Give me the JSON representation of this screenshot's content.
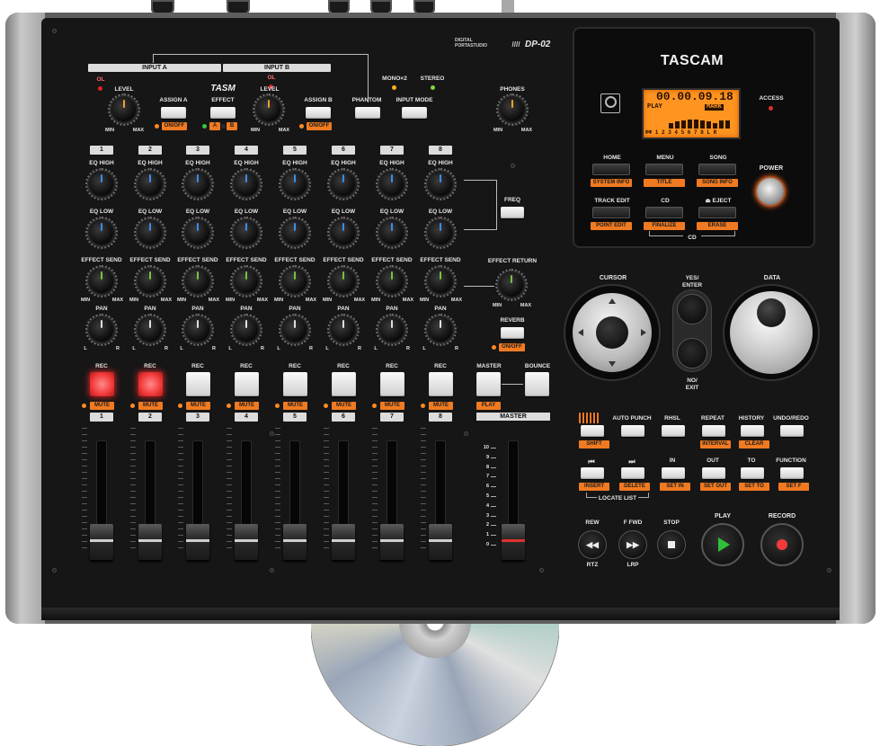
{
  "device": {
    "brand": "TASCAM",
    "panel_brand": "TASM",
    "model_small": "DIGITAL\nPORTASTUDIO",
    "model_slashes": "////",
    "model": "DP-02"
  },
  "inputs": {
    "input_a": "INPUT A",
    "input_b": "INPUT B",
    "ol": "OL",
    "level": "LEVEL",
    "min": "MIN",
    "max": "MAX",
    "assign_a": "ASSIGN A",
    "assign_b": "ASSIGN B",
    "effect": "EFFECT",
    "on_off": "ON/OFF",
    "a": "A",
    "b": "B",
    "phantom": "PHANTOM",
    "mono_x2": "MONO×2",
    "stereo": "STEREO",
    "input_mode": "INPUT MODE",
    "phones": "PHONES"
  },
  "channels": [
    "1",
    "2",
    "3",
    "4",
    "5",
    "6",
    "7",
    "8"
  ],
  "mixer": {
    "eq_high": "EQ HIGH",
    "eq_low": "EQ LOW",
    "effect_send": "EFFECT SEND",
    "pan": "PAN",
    "l": "L",
    "r": "R",
    "min": "MIN",
    "max": "MAX",
    "freq": "FREQ",
    "effect_return": "EFFECT RETURN",
    "reverb": "REVERB",
    "on_off": "ON/OFF",
    "rec": "REC",
    "mute": "MUTE",
    "master": "MASTER",
    "bounce": "BOUNCE",
    "play": "PLAY",
    "master_strip": "MASTER",
    "fader_scale": [
      "10",
      "9",
      "8",
      "7",
      "6",
      "5",
      "4",
      "3",
      "2",
      "1",
      "0"
    ]
  },
  "display": {
    "time": "00.00.09.18",
    "status": "PLAY",
    "mark": "MARK",
    "access": "ACCESS",
    "meters": "ΦΦ 1 2 3 4 5 6 7 8 L R"
  },
  "top_buttons": [
    {
      "label": "HOME",
      "sub": "SYSTEM INFO"
    },
    {
      "label": "MENU",
      "sub": "TITLE"
    },
    {
      "label": "SONG",
      "sub": "SONG INFO"
    },
    {
      "label": "TRACK EDIT",
      "sub": "POINT EDIT"
    },
    {
      "label": "CD",
      "sub": "FINALIZE"
    },
    {
      "label": "⏏ EJECT",
      "sub": "ERASE"
    }
  ],
  "cd_group": "CD",
  "power": "POWER",
  "navigation": {
    "cursor": "CURSOR",
    "yes_enter": "YES/\nENTER",
    "no_exit": "NO/\nEXIT",
    "data": "DATA"
  },
  "function_row1": [
    {
      "label": "",
      "sub": "SHIFT"
    },
    {
      "label": "AUTO PUNCH",
      "sub": ""
    },
    {
      "label": "RHSL",
      "sub": ""
    },
    {
      "label": "REPEAT",
      "sub": "INTERVAL"
    },
    {
      "label": "HISTORY",
      "sub": "CLEAR"
    },
    {
      "label": "UNDO/REDO",
      "sub": ""
    }
  ],
  "function_row2": [
    {
      "label": "⏮",
      "sub": "INSERT"
    },
    {
      "label": "⏭",
      "sub": "DELETE"
    },
    {
      "label": "IN",
      "sub": "SET IN"
    },
    {
      "label": "OUT",
      "sub": "SET OUT"
    },
    {
      "label": "TO",
      "sub": "SET TO"
    },
    {
      "label": "FUNCTION",
      "sub": "SET F"
    }
  ],
  "locate_list": "LOCATE LIST",
  "transport": {
    "rew": "REW",
    "ffwd": "F FWD",
    "stop": "STOP",
    "play": "PLAY",
    "record": "RECORD",
    "rtz": "RTZ",
    "lrp": "LRP"
  },
  "colors": {
    "body": "#161616",
    "side_silver": "#b4b4b4",
    "accent_orange": "#f07a22",
    "lcd": "#ff9420",
    "rec_red": "#f23a3a",
    "play_green": "#2fbf3a"
  }
}
